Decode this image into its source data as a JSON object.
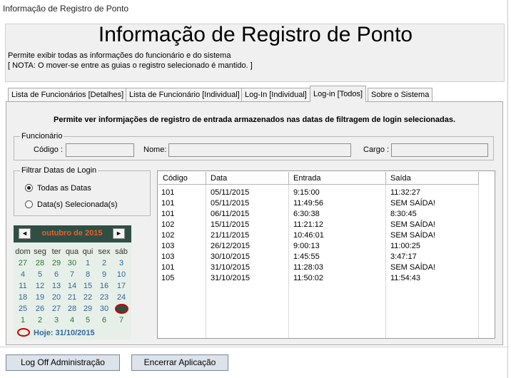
{
  "window": {
    "title": "Informação de Registro de Ponto"
  },
  "header": {
    "title": "Informação de Registro de Ponto",
    "desc_line1": "Permite exibir todas as informações do funcionário e do sistema",
    "desc_line2": "[ NOTA: O mover-se entre as guias o registro selecionado é mantido. ]"
  },
  "tabs": [
    {
      "label": "Lista de Funcionários [Detalhes]"
    },
    {
      "label": "Lista de Funcionário [Individual]"
    },
    {
      "label": "Log-In [Individual]"
    },
    {
      "label": "Log-in [Todos]",
      "active": true
    },
    {
      "label": "Sobre o Sistema"
    }
  ],
  "panel": {
    "description": "Permite ver informjações de registro de entrada armazenados nas datas de filtragem de login selecionadas.",
    "employee_group": {
      "legend": "Funcionário",
      "code_label": "Código :",
      "code_value": "",
      "name_label": "Nome:",
      "name_value": "",
      "role_label": "Cargo :",
      "role_value": ""
    },
    "filter_group": {
      "legend": "Filtrar Datas de Login",
      "option_all": "Todas as Datas",
      "option_selected": "Data(s) Selecionada(s)",
      "selected_option": "all"
    }
  },
  "calendar": {
    "month_label": "outubro de 2015",
    "prev_icon": "◄",
    "next_icon": "►",
    "weekdays": [
      "dom",
      "seg",
      "ter",
      "qua",
      "qui",
      "sex",
      "sáb"
    ],
    "weeks": [
      [
        "27",
        "28",
        "29",
        "30",
        "1",
        "2",
        "3"
      ],
      [
        "4",
        "5",
        "6",
        "7",
        "8",
        "9",
        "10"
      ],
      [
        "11",
        "12",
        "13",
        "14",
        "15",
        "16",
        "17"
      ],
      [
        "18",
        "19",
        "20",
        "21",
        "22",
        "23",
        "24"
      ],
      [
        "25",
        "26",
        "27",
        "28",
        "29",
        "30",
        "31"
      ],
      [
        "1",
        "2",
        "3",
        "4",
        "5",
        "6",
        "7"
      ]
    ],
    "today_label": "Hoje: 31/10/2015",
    "today_day": "31"
  },
  "grid": {
    "columns": [
      "Código",
      "Data",
      "Entrada",
      "Saída"
    ],
    "rows": [
      [
        "101",
        "05/11/2015",
        "9:15:00",
        "11:32:27"
      ],
      [
        "101",
        "05/11/2015",
        "11:49:56",
        "SEM SAÍDA!"
      ],
      [
        "101",
        "06/11/2015",
        "6:30:38",
        "8:30:45"
      ],
      [
        "102",
        "15/11/2015",
        "11:21:12",
        "SEM SAÍDA!"
      ],
      [
        "102",
        "21/11/2015",
        "10:46:01",
        "SEM SAÍDA!"
      ],
      [
        "103",
        "26/12/2015",
        "9:00:13",
        "11:00:25"
      ],
      [
        "103",
        "30/10/2015",
        "1:45:55",
        "3:47:17"
      ],
      [
        "101",
        "31/10/2015",
        "11:28:03",
        "SEM SAÍDA!"
      ],
      [
        "105",
        "31/10/2015",
        "11:50:02",
        "11:54:43"
      ]
    ]
  },
  "buttons": {
    "logoff": "Log Off Administração",
    "exit": "Encerrar Aplicação"
  },
  "colors": {
    "calendar_header": "#2f4f45",
    "calendar_bg": "#e6f0e9",
    "month_text": "#e8602a",
    "day_text": "#336699",
    "other_month_text": "#2a7a2a",
    "today_marker": "#cc0000"
  }
}
